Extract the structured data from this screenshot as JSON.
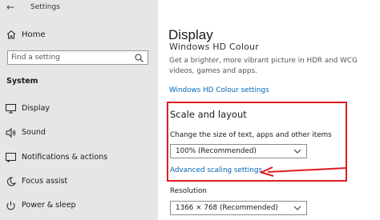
{
  "window": {
    "title": "Settings",
    "back_glyph": "←"
  },
  "sidebar": {
    "home_label": "Home",
    "search": {
      "placeholder": "Find a setting",
      "icon": "search-icon"
    },
    "section_label": "System",
    "items": [
      {
        "label": "Display",
        "icon": "monitor-icon"
      },
      {
        "label": "Sound",
        "icon": "speaker-icon"
      },
      {
        "label": "Notifications & actions",
        "icon": "notifications-icon"
      },
      {
        "label": "Focus assist",
        "icon": "moon-icon"
      },
      {
        "label": "Power & sleep",
        "icon": "power-icon"
      }
    ]
  },
  "main": {
    "title": "Display",
    "hd_section": {
      "heading": "Windows HD Colour",
      "description": "Get a brighter, more vibrant picture in HDR and WCG videos, games and apps.",
      "link": "Windows HD Colour settings"
    },
    "scale_section": {
      "heading": "Scale and layout",
      "description": "Change the size of text, apps and other items",
      "dropdown_value": "100% (Recommended)",
      "advanced_link": "Advanced scaling settings"
    },
    "resolution_section": {
      "label": "Resolution",
      "dropdown_value": "1366 × 768 (Recommended)"
    }
  },
  "colors": {
    "sidebar_bg": "#e6e6e6",
    "link": "#0067b8",
    "highlight": "#e31b23"
  }
}
